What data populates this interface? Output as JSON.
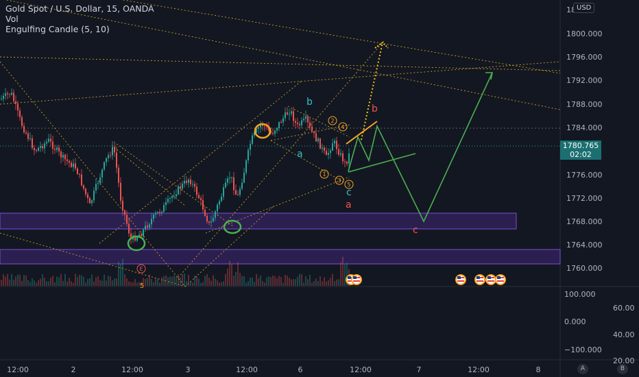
{
  "legend": {
    "title": "Gold Spot / U.S. Dollar, 15, OANDA",
    "vol": "Vol",
    "indicator": "Engulfing Candle (5, 10)"
  },
  "currency_button": "USD",
  "last_price": {
    "value": "1780.765",
    "countdown": "02:02"
  },
  "price_axis": [
    "1800.000",
    "1796.000",
    "1792.000",
    "1788.000",
    "1784.000",
    "1776.000",
    "1772.000",
    "1768.000",
    "1764.000",
    "1760.000"
  ],
  "price_axis_top_partial": "18",
  "indicator_axis_left": [
    "100.000",
    "0.000",
    "−100.000"
  ],
  "indicator_axis_right": [
    "60.00",
    "40.00",
    "20.00"
  ],
  "time_axis": [
    "12:00",
    "2",
    "12:00",
    "3",
    "12:00",
    "6",
    "12:00",
    "7",
    "12:00",
    "8"
  ],
  "wave_labels": {
    "b_upper": "b",
    "a_mid": "a",
    "c_mid": "c",
    "a_red": "a",
    "b_red": "b",
    "c_red": "c",
    "circle_2": "2",
    "circle_4": "4",
    "circle_1": "1",
    "circle_3": "3",
    "circle_5": "5",
    "circle_e": "E",
    "circle_5_bottom": "5"
  },
  "corner_buttons": [
    "A",
    "B"
  ],
  "colors": {
    "background": "#131722",
    "zone": "#4a2a8a",
    "up": "#26a69a",
    "down": "#ef5350",
    "projection": "#4caf50",
    "ellipse_orange": "#f5a623",
    "ellipse_green": "#4caf50"
  }
}
